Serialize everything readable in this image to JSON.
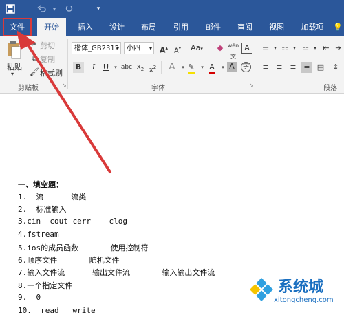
{
  "titlebar": {
    "save_icon": "save-icon",
    "undo_icon": "undo-icon",
    "redo_icon": "redo-icon",
    "qat_icon": "customize-icon"
  },
  "tabs": [
    {
      "label": "文件"
    },
    {
      "label": "开始"
    },
    {
      "label": "插入"
    },
    {
      "label": "设计"
    },
    {
      "label": "布局"
    },
    {
      "label": "引用"
    },
    {
      "label": "邮件"
    },
    {
      "label": "审阅"
    },
    {
      "label": "视图"
    },
    {
      "label": "加载项"
    }
  ],
  "clipboard": {
    "paste_label": "粘贴",
    "cut_label": "剪切",
    "copy_label": "复制",
    "format_painter_label": "格式刷",
    "group_label": "剪贴板"
  },
  "font": {
    "name": "楷体_GB2312",
    "size": "小四",
    "group_label": "字体",
    "highlight_color": "#f5e000",
    "font_color": "#d40000"
  },
  "paragraph": {
    "group_label": "段落"
  },
  "doc": {
    "lines": [
      "一、填空题：",
      "1.  流      流类",
      "2.  标准输入",
      "3.cin  cout cerr    clog",
      "4.fstream",
      "5.ios的成员函数       使用控制符",
      "6.顺序文件       随机文件",
      "7.输入文件流      输出文件流       输入输出文件流",
      "8.一个指定文件",
      "9.  0",
      "10.  read   write"
    ]
  },
  "watermark": {
    "brand": "系统城",
    "url": "xitongcheng.com"
  },
  "colors": {
    "accent": "#2b579a",
    "arrow": "#d93a3a"
  }
}
